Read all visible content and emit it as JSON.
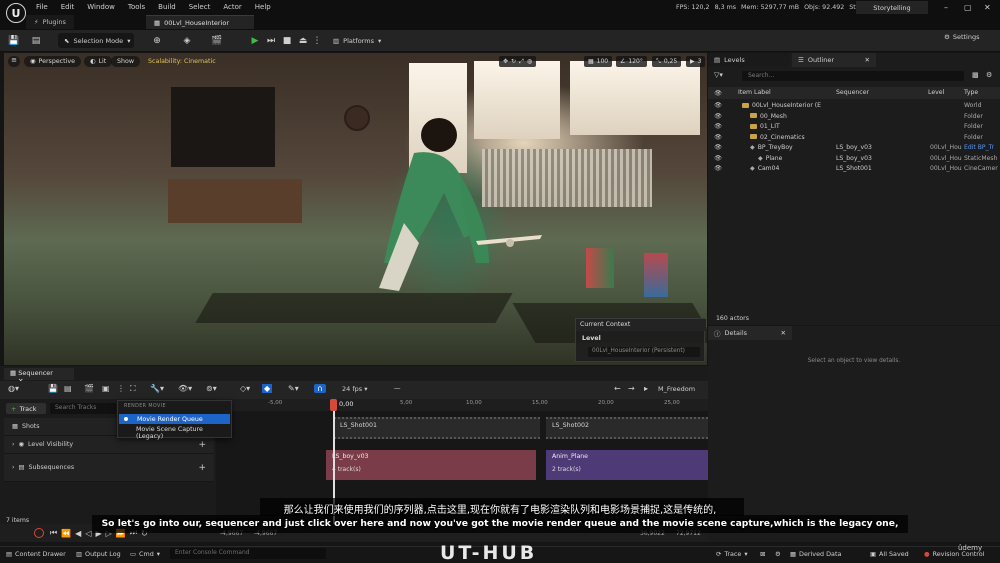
{
  "titlebar": {
    "logo": "U",
    "menu": [
      "File",
      "Edit",
      "Window",
      "Tools",
      "Build",
      "Select",
      "Actor",
      "Help"
    ],
    "tabs": [
      {
        "label": "Plugins",
        "icon": "plug-icon"
      },
      {
        "label": "00Lvl_HouseInterior",
        "icon": "level-icon"
      }
    ],
    "stats": {
      "fps": "FPS: 120,2",
      "ms": "8,3 ms",
      "mem": "Mem: 5297,77 mB",
      "objs": "Objs: 92.492",
      "stats": "Stats: 4"
    },
    "workspace": "Storytelling",
    "window_controls": [
      "–",
      "▢",
      "✕"
    ]
  },
  "toolbar": {
    "mode": "Selection Mode",
    "platforms": "Platforms",
    "settings": "Settings",
    "play_color": "#3fbf3f"
  },
  "viewport": {
    "buttons": [
      "Perspective",
      "Lit",
      "Show"
    ],
    "scalability": "Scalability: Cinematic",
    "right_values": [
      "100",
      "120°",
      "0,25",
      "3"
    ],
    "context": {
      "header": "Current Context",
      "level_label": "Level",
      "level_value": "00Lvl_HouseInterior (Persistent)"
    }
  },
  "outliner": {
    "tab_levels": "Levels",
    "tab_outliner": "Outliner",
    "search_placeholder": "Search...",
    "columns": [
      "Item Label",
      "Sequencer",
      "Level",
      "Type"
    ],
    "rows": [
      {
        "label": "00Lvl_HouseInterior (E",
        "sequencer": "",
        "level": "",
        "type": "World",
        "indent": 0
      },
      {
        "label": "00_Mesh",
        "sequencer": "",
        "level": "",
        "type": "Folder",
        "indent": 1
      },
      {
        "label": "01_LIT",
        "sequencer": "",
        "level": "",
        "type": "Folder",
        "indent": 1
      },
      {
        "label": "02_Cinematics",
        "sequencer": "",
        "level": "",
        "type": "Folder",
        "indent": 1
      },
      {
        "label": "BP_TreyBoy",
        "sequencer": "LS_boy_v03",
        "level": "00Lvl_Hou",
        "type": "Edit BP_Tr",
        "indent": 1
      },
      {
        "label": "Plane",
        "sequencer": "LS_boy_v03",
        "level": "00Lvl_Hou",
        "type": "StaticMesh",
        "indent": 2
      },
      {
        "label": "Cam04",
        "sequencer": "LS_Shot001",
        "level": "00Lvl_Hou",
        "type": "CineCamer",
        "indent": 1
      }
    ],
    "actor_count": "160 actors"
  },
  "details": {
    "tab": "Details",
    "empty": "Select an object to view details."
  },
  "sequencer": {
    "tab": "Sequencer",
    "fps": "24 fps",
    "sequence_name": "M_Freedom",
    "add_track": "Track",
    "search_placeholder": "Search Tracks",
    "tracks": [
      "Shots",
      "Level Visibility",
      "Subsequences"
    ],
    "ruler": {
      "start": "0,00",
      "labels": [
        "-5,00",
        "5,00",
        "10,00",
        "15,00",
        "20,00",
        "25,00",
        "30,00"
      ]
    },
    "shots": [
      "LS_Shot001",
      "LS_Shot002"
    ],
    "subsequences": [
      {
        "name": "LS_boy_v03",
        "tracks": "4 track(s)"
      },
      {
        "name": "Anim_Plane",
        "tracks": "2 track(s)"
      }
    ],
    "items_count": "7 items",
    "transport_left": [
      "-4,9667",
      "-4,9667"
    ],
    "transport_right": [
      "36,9022",
      "72,9712"
    ]
  },
  "dropdown": {
    "header": "RENDER MOVIE",
    "items": [
      "Movie Render Queue",
      "Movie Scene Capture (Legacy)"
    ]
  },
  "statusbar": {
    "content_drawer": "Content Drawer",
    "output_log": "Output Log",
    "cmd": "Cmd",
    "console_placeholder": "Enter Console Command",
    "watermark": "UT-HUB",
    "trace": "Trace",
    "derived_data": "Derived Data",
    "all_saved": "All Saved",
    "revision_control": "Revision Control",
    "udemy": "ûdemy"
  },
  "subtitles": {
    "cn": "那么让我们来使用我们的序列器,点击这里,现在你就有了电影渲染队列和电影场景捕捉,这是传统的,",
    "en": "So let's go into our, sequencer and just click over here and now you've got the movie render queue and the movie scene capture,which is the legacy one,"
  }
}
